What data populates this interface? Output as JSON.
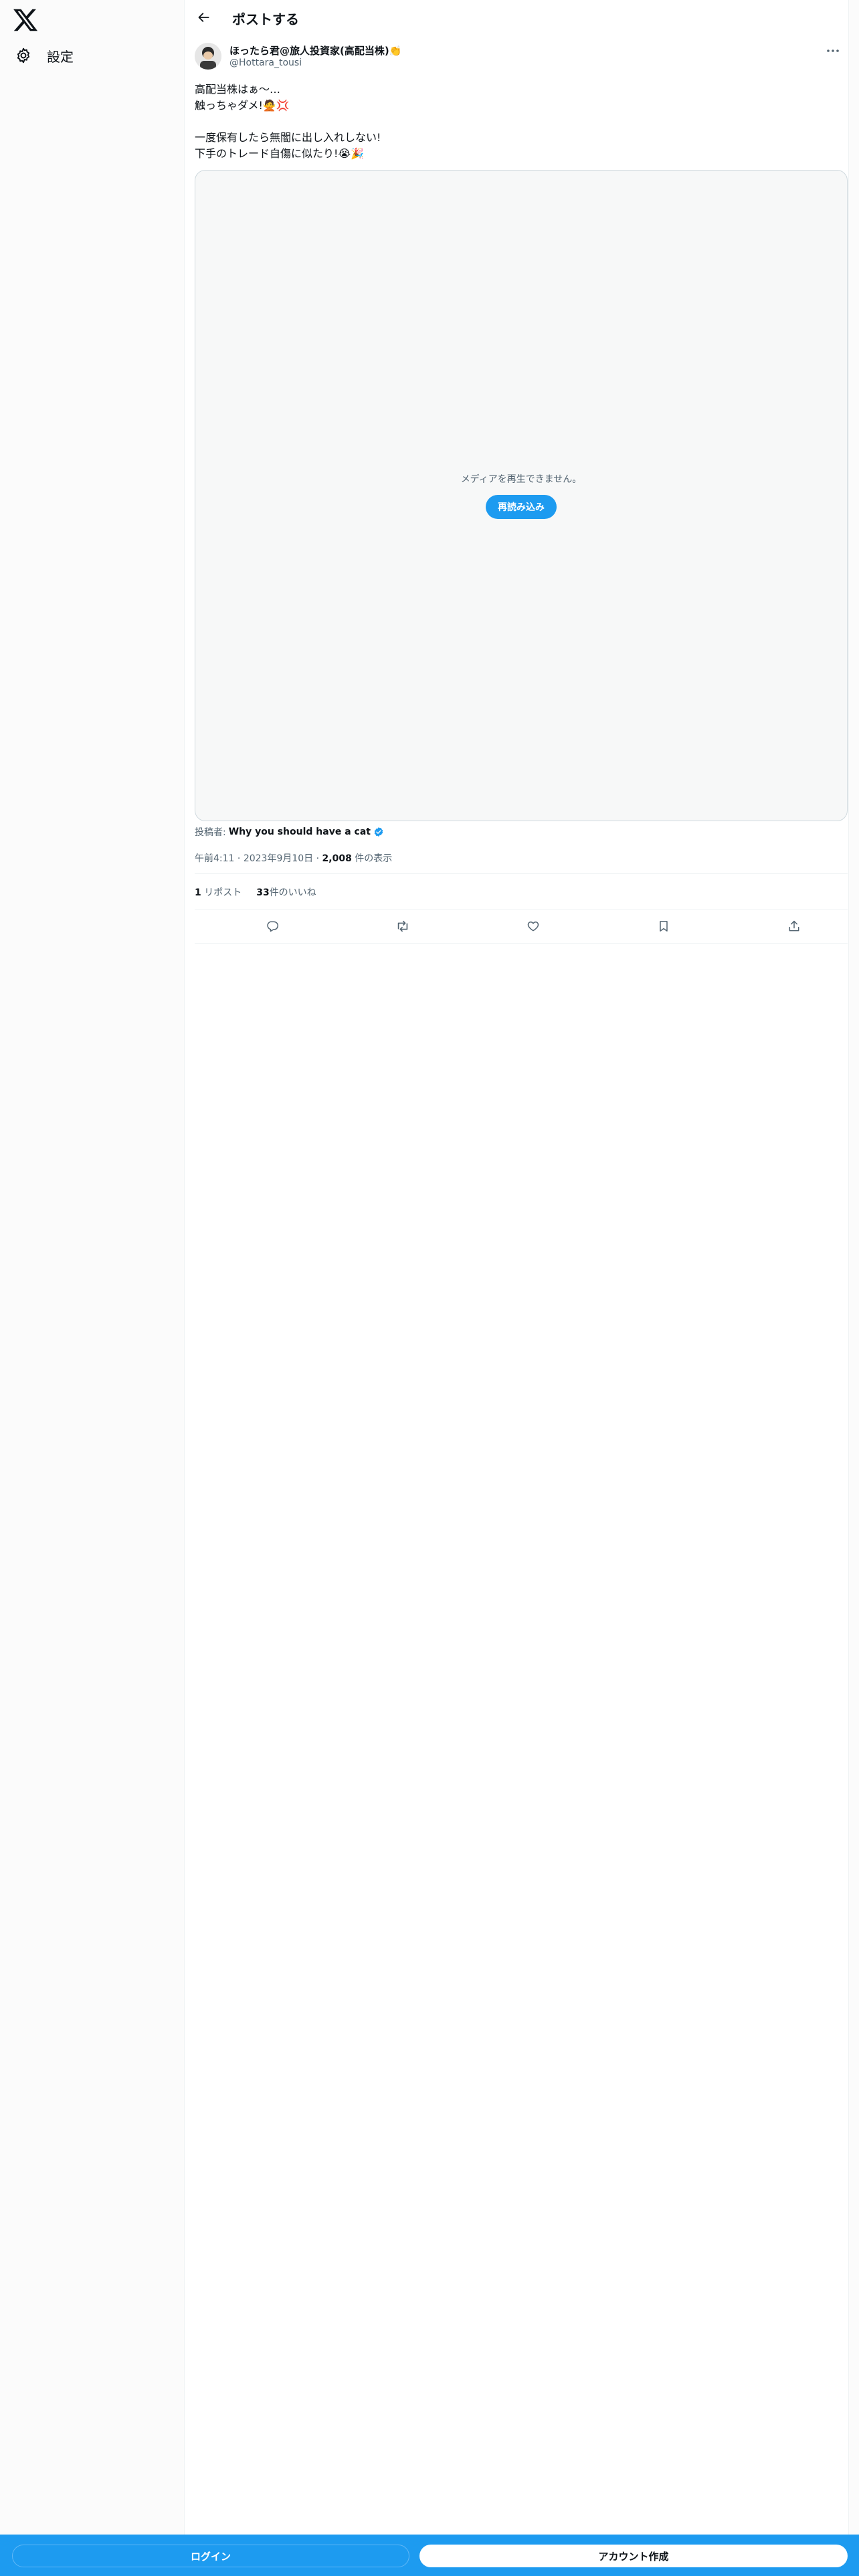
{
  "sidebar": {
    "logo_icon": "x-logo-icon",
    "items": [
      {
        "label": "設定",
        "icon": "gear-icon"
      }
    ]
  },
  "header": {
    "title": "ポストする",
    "back_icon": "back-arrow-icon"
  },
  "post": {
    "author_name": "ほったら君@旅人投資家(高配当株)👏",
    "author_handle": "@Hottara_tousi",
    "text_lines": [
      "高配当株はぁ〜…",
      "触っちゃダメ!🙅💢",
      "",
      "一度保有したら無闇に出し入れしない!",
      "下手のトレード自傷に似たり!😭🎉"
    ],
    "media_message": "メディアを再生できません。",
    "reload_label": "再読み込み",
    "posted_by_prefix": "投稿者:",
    "posted_by_account": "Why you should have a cat",
    "time": "午前4:11",
    "date": "2023年9月10日",
    "separator": "·",
    "views_count": "2,008",
    "views_label": "件の表示",
    "reposts_count": "1",
    "reposts_label": "リポスト",
    "likes_count": "33",
    "likes_label": "件のいいね"
  },
  "actions": [
    "reply-icon",
    "repost-icon",
    "like-icon",
    "bookmark-icon",
    "share-icon"
  ],
  "bottom_bar": {
    "login_label": "ログイン",
    "signup_label": "アカウント作成"
  },
  "colors": {
    "accent": "#1d9bf0",
    "text": "#0f1419",
    "secondary": "#536471",
    "verified": "#1d9bf0"
  }
}
